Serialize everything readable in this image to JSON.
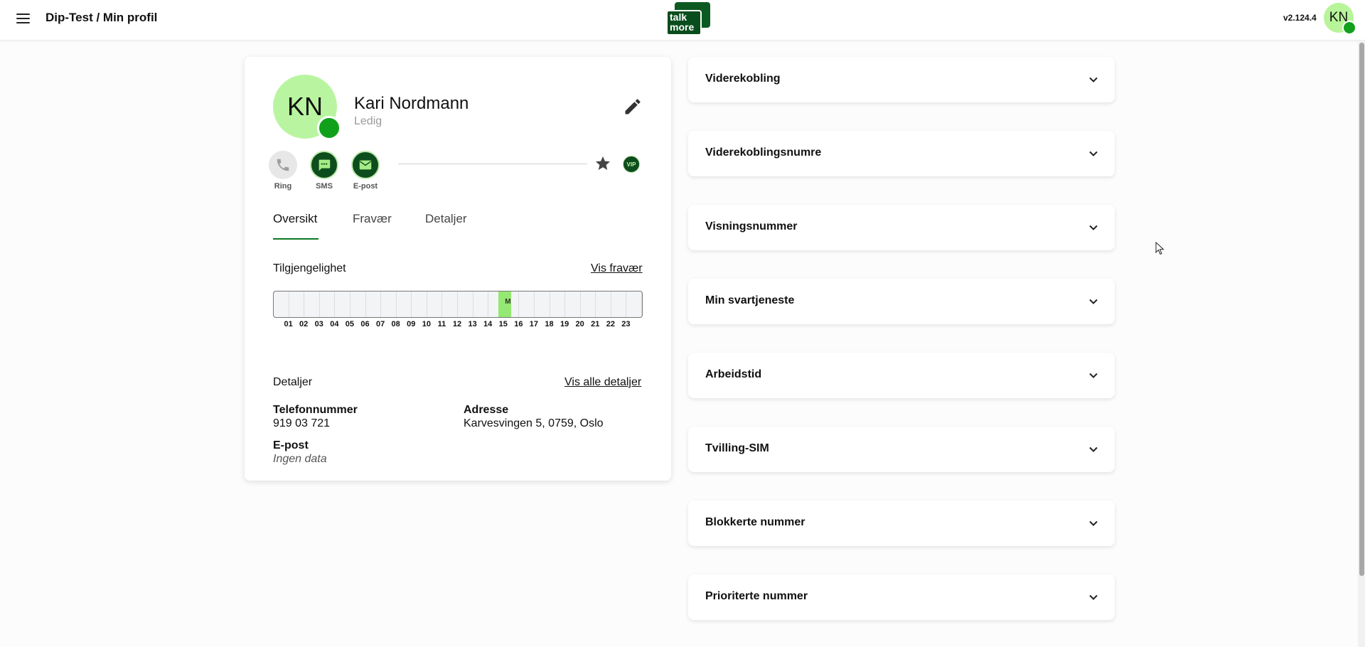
{
  "header": {
    "breadcrumb": "Dip-Test / Min profil",
    "logo_text_line1": "talk",
    "logo_text_line2": "more",
    "version": "v2.124.4",
    "user_initials": "KN"
  },
  "profile": {
    "initials": "KN",
    "name": "Kari Nordmann",
    "status": "Ledig",
    "presence_color": "#10a01a",
    "actions": [
      {
        "label": "Ring",
        "icon": "phone-icon"
      },
      {
        "label": "SMS",
        "icon": "chat-icon"
      },
      {
        "label": "E-post",
        "icon": "mail-icon"
      }
    ],
    "vip_label": "VIP",
    "tabs": [
      "Oversikt",
      "Fravær",
      "Detaljer"
    ],
    "active_tab": "Oversikt"
  },
  "availability": {
    "title": "Tilgjengelighet",
    "link": "Vis fravær",
    "hours": [
      "01",
      "02",
      "03",
      "04",
      "05",
      "06",
      "07",
      "08",
      "09",
      "10",
      "11",
      "12",
      "13",
      "14",
      "15",
      "16",
      "17",
      "18",
      "19",
      "20",
      "21",
      "22",
      "23"
    ],
    "marker_label": "M",
    "marker_hour": 15,
    "marker_color": "#95e873"
  },
  "details": {
    "title": "Detaljer",
    "link": "Vis alle detaljer",
    "phone_label": "Telefonnummer",
    "phone_value": "919 03 721",
    "address_label": "Adresse",
    "address_value": "Karvesvingen 5, 0759, Oslo",
    "email_label": "E-post",
    "email_value": "Ingen data"
  },
  "panels": [
    "Viderekobling",
    "Viderekoblingsnumre",
    "Visningsnummer",
    "Min svartjeneste",
    "Arbeidstid",
    "Tvilling-SIM",
    "Blokkerte nummer",
    "Prioriterte nummer"
  ],
  "colors": {
    "brand_dark_green": "#0d4d1d",
    "accent_green": "#0d7a24",
    "avatar_bg": "#b9f5a0"
  }
}
